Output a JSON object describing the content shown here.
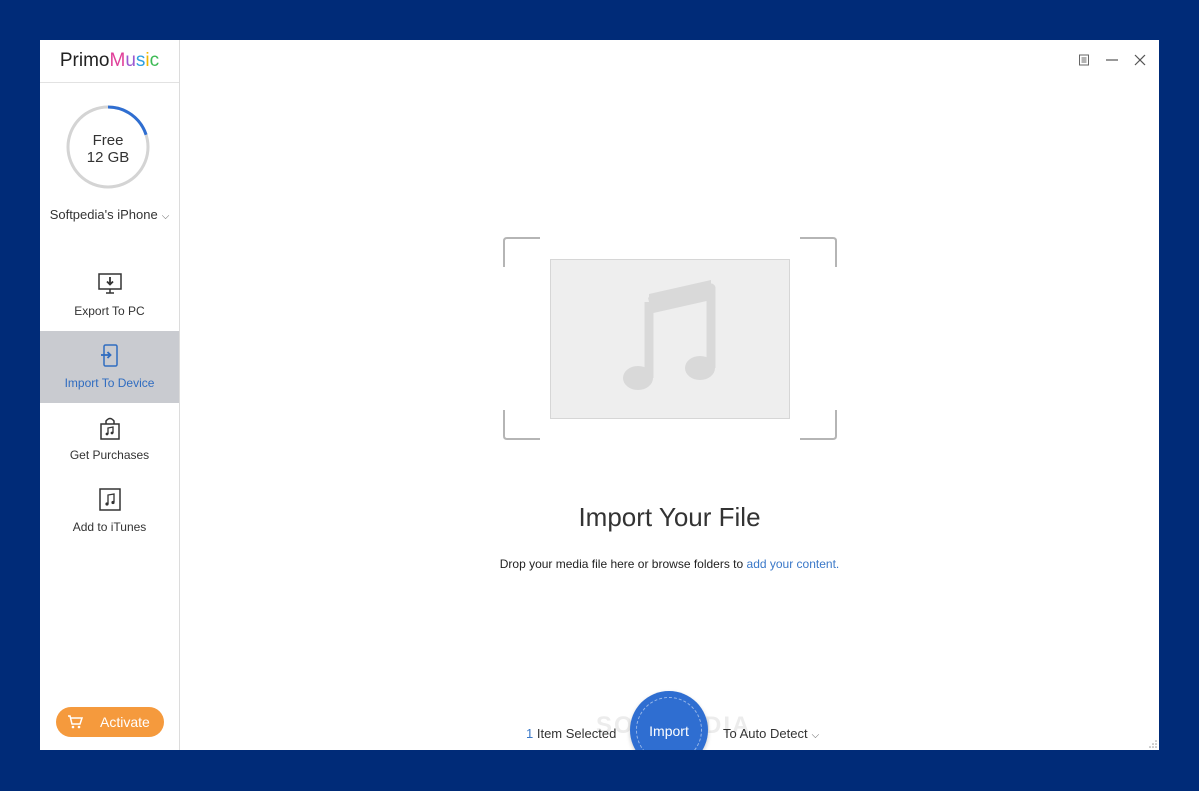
{
  "app": {
    "logo_primo": "Primo",
    "logo_music": [
      "M",
      "u",
      "s",
      "i",
      "c"
    ]
  },
  "window_controls": {
    "menu_icon": "menu-icon",
    "minimize_icon": "minimize-icon",
    "close_icon": "close-icon"
  },
  "storage": {
    "label": "Free",
    "value": "12 GB",
    "used_fraction": 0.2
  },
  "device": {
    "name": "Softpedia's iPhone",
    "chevron": "⌵"
  },
  "nav": {
    "items": [
      {
        "label": "Export To PC",
        "icon": "monitor-download-icon",
        "active": false
      },
      {
        "label": "Import To Device",
        "icon": "phone-import-icon",
        "active": true
      },
      {
        "label": "Get Purchases",
        "icon": "bag-music-icon",
        "active": false
      },
      {
        "label": "Add to iTunes",
        "icon": "itunes-note-icon",
        "active": false
      }
    ]
  },
  "activate": {
    "label": "Activate",
    "icon": "cart-icon"
  },
  "main": {
    "headline": "Import Your File",
    "sub_prefix": "Drop your media file here or browse folders to ",
    "sub_link": "add your content."
  },
  "bottom": {
    "count": "1",
    "selected_suffix": " Item Selected",
    "import_label": "Import",
    "target": "To Auto Detect",
    "target_chevron": "⌵",
    "watermark": "SOFTPEDIA"
  },
  "colors": {
    "accent": "#2f6ed1",
    "activate": "#f59a3d",
    "background": "#002b78",
    "link": "#3a78c8"
  }
}
